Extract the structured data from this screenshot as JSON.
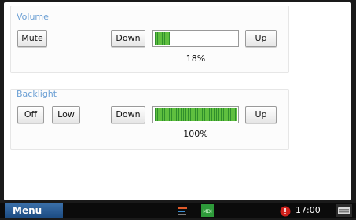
{
  "volume": {
    "title": "Volume",
    "mute_label": "Mute",
    "down_label": "Down",
    "up_label": "Up",
    "level_percent": 18,
    "level_text": "18%"
  },
  "backlight": {
    "title": "Backlight",
    "off_label": "Off",
    "low_label": "Low",
    "down_label": "Down",
    "up_label": "Up",
    "level_percent": 100,
    "level_text": "100%"
  },
  "taskbar": {
    "menu_label": "Menu",
    "clock": "17:00",
    "icons": [
      "network-chart-icon",
      "mdi-app-icon",
      "alert-icon",
      "keyboard-icon"
    ]
  },
  "colors": {
    "accent_title": "#6b9fd4",
    "bar_green": "#5fbf3f",
    "alert_red": "#d0201b",
    "menu_blue": "#2a5f98"
  }
}
